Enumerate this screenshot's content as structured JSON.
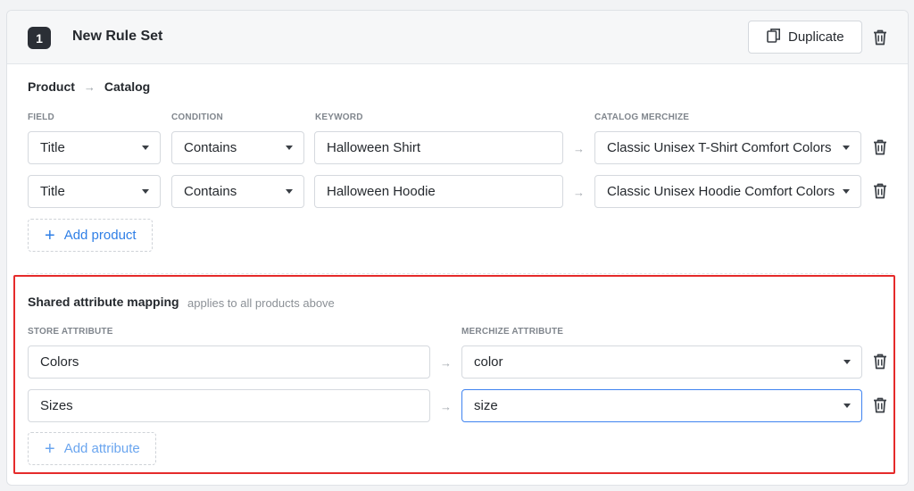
{
  "rule_set": {
    "number": "1",
    "title": "New Rule Set",
    "duplicate_label": "Duplicate"
  },
  "breadcrumb": {
    "from": "Product",
    "to": "Catalog"
  },
  "product_columns": {
    "field": "FIELD",
    "condition": "CONDITION",
    "keyword": "KEYWORD",
    "catalog": "CATALOG MERCHIZE"
  },
  "product_rows": [
    {
      "field": "Title",
      "condition": "Contains",
      "keyword": "Halloween Shirt",
      "catalog": "Classic Unisex T-Shirt Comfort Colors"
    },
    {
      "field": "Title",
      "condition": "Contains",
      "keyword": "Halloween Hoodie",
      "catalog": "Classic Unisex Hoodie Comfort Colors"
    }
  ],
  "add_product_label": "Add product",
  "shared": {
    "title": "Shared attribute mapping",
    "subtitle": "applies to all products above",
    "store_col": "STORE ATTRIBUTE",
    "merchize_col": "MERCHIZE ATTRIBUTE",
    "rows": [
      {
        "store": "Colors",
        "merchize": "color"
      },
      {
        "store": "Sizes",
        "merchize": "size"
      }
    ],
    "add_attribute_label": "Add attribute"
  },
  "colors": {
    "accent": "#2f7fe6",
    "highlight": "#e52b2b",
    "badge": "#2b2f36"
  }
}
